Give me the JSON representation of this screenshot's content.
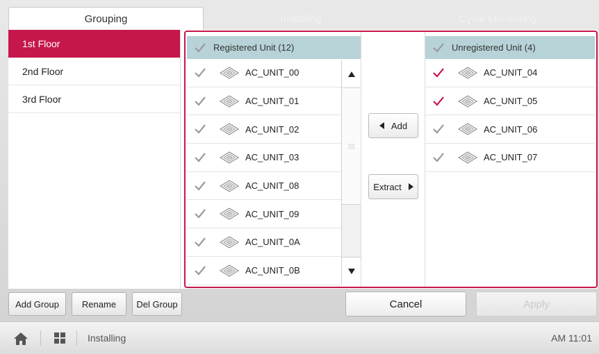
{
  "tabs": [
    {
      "label": "Grouping",
      "active": true
    },
    {
      "label": "Installing",
      "active": false
    },
    {
      "label": "Cycle Monitoring",
      "active": false
    }
  ],
  "floors": [
    {
      "label": "1st Floor",
      "selected": true
    },
    {
      "label": "2nd Floor",
      "selected": false
    },
    {
      "label": "3rd Floor",
      "selected": false
    }
  ],
  "registered": {
    "header": "Registered Unit (12)",
    "units": [
      {
        "name": "AC_UNIT_00",
        "checked": false
      },
      {
        "name": "AC_UNIT_01",
        "checked": false
      },
      {
        "name": "AC_UNIT_02",
        "checked": false
      },
      {
        "name": "AC_UNIT_03",
        "checked": false
      },
      {
        "name": "AC_UNIT_08",
        "checked": false
      },
      {
        "name": "AC_UNIT_09",
        "checked": false
      },
      {
        "name": "AC_UNIT_0A",
        "checked": false
      },
      {
        "name": "AC_UNIT_0B",
        "checked": false
      }
    ]
  },
  "unregistered": {
    "header": "Unregistered Unit (4)",
    "units": [
      {
        "name": "AC_UNIT_04",
        "checked": true
      },
      {
        "name": "AC_UNIT_05",
        "checked": true
      },
      {
        "name": "AC_UNIT_06",
        "checked": false
      },
      {
        "name": "AC_UNIT_07",
        "checked": false
      }
    ]
  },
  "middle": {
    "add_label": "Add",
    "extract_label": "Extract"
  },
  "group_buttons": {
    "add_group": "Add Group",
    "rename": "Rename",
    "del_group": "Del Group"
  },
  "actions": {
    "cancel": "Cancel",
    "apply": "Apply"
  },
  "statusbar": {
    "breadcrumb": "Installing",
    "time": "AM 11:01"
  },
  "colors": {
    "accent": "#c6174a",
    "header_bg": "#b7d3d8",
    "check_grey": "#9a9a9a"
  },
  "icons": {
    "home": "home-icon",
    "menu": "grid-menu-icon",
    "unit": "ceiling-cassette-icon",
    "check": "check-icon"
  }
}
